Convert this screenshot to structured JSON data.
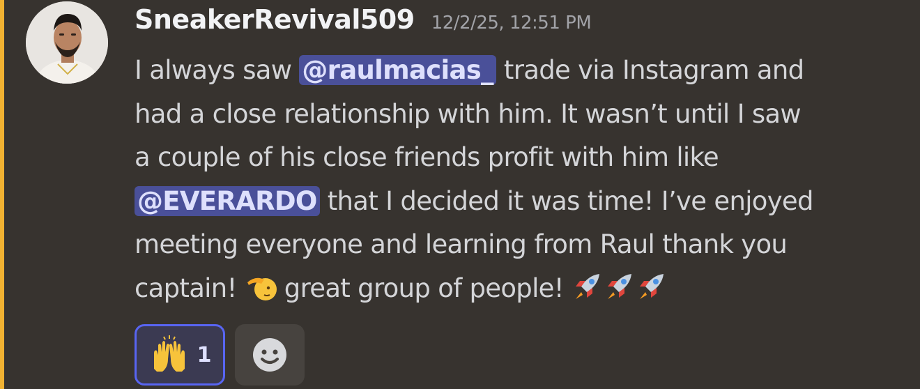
{
  "message": {
    "username": "SneakerRevival509",
    "timestamp": "12/2/25, 12:51 PM",
    "avatar_icon": "user-avatar-photo",
    "lines": [
      {
        "before": "I always saw ",
        "mention": "@raulmacias_",
        "after": " trade via Instagram and"
      },
      {
        "text": "had a close relationship with him. It wasn’t until I saw"
      },
      {
        "text": "a couple of his close friends profit with him like"
      },
      {
        "mention": "@EVERARDO",
        "after": " that I decided it was time! I’ve enjoyed"
      },
      {
        "text": "meeting everyone and learning from Raul thank you"
      },
      {
        "before": "captain! ",
        "emoji": "saluting-face",
        "after": " great group of people! ",
        "trailing_emojis": [
          "rocket",
          "rocket",
          "rocket"
        ]
      }
    ]
  },
  "reactions": [
    {
      "emoji": "raising-hands",
      "count": "1",
      "selected": true
    }
  ],
  "add_reaction": {
    "icon": "add-reaction-smiley"
  },
  "colors": {
    "background": "#37332f",
    "accent_bar": "#f0b232",
    "mention_bg": "#4a5099",
    "reaction_border": "#5865f2"
  }
}
